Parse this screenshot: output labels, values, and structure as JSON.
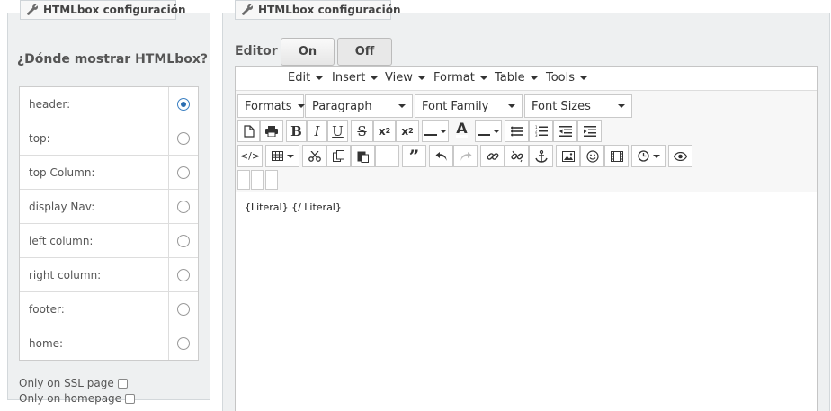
{
  "left_panel": {
    "legend": "HTMLbox configuración",
    "title": "¿Dónde mostrar HTMLbox?",
    "hooks": [
      {
        "label": "header:",
        "checked": true
      },
      {
        "label": "top:",
        "checked": false
      },
      {
        "label": "top Column:",
        "checked": false
      },
      {
        "label": "display Nav:",
        "checked": false
      },
      {
        "label": "left column:",
        "checked": false
      },
      {
        "label": "right column:",
        "checked": false
      },
      {
        "label": "footer:",
        "checked": false
      },
      {
        "label": "home:",
        "checked": false
      }
    ],
    "ssl_option": "Only on SSL page",
    "homepage_option": "Only on homepage"
  },
  "right_panel": {
    "legend": "HTMLbox configuración",
    "editor_label": "Editor",
    "on_label": "On",
    "off_label": "Off"
  },
  "menubar": [
    "Edit",
    "Insert",
    "View",
    "Format",
    "Table",
    "Tools"
  ],
  "dropdowns": {
    "formats": "Formats",
    "block": "Paragraph",
    "font_family": "Font Family",
    "font_sizes": "Font Sizes"
  },
  "editor_content": "{Literal} {/ Literal}",
  "icons": {
    "wrench": "wrench-icon",
    "toolbar": [
      "new-document-icon",
      "print-icon",
      "bold-icon",
      "italic-icon",
      "underline-icon",
      "strikethrough-icon",
      "superscript-icon",
      "subscript-icon",
      "text-color-icon",
      "background-color-icon",
      "bullet-list-icon",
      "numbered-list-icon",
      "outdent-icon",
      "indent-icon",
      "code-icon",
      "table-icon",
      "cut-icon",
      "copy-icon",
      "paste-icon",
      "blockquote-icon",
      "undo-icon",
      "redo-icon",
      "link-icon",
      "unlink-icon",
      "anchor-icon",
      "image-icon",
      "emoticon-icon",
      "media-icon",
      "insert-time-icon",
      "preview-icon"
    ]
  },
  "colors": {
    "panel_bg": "#eef0f1",
    "radio_checked": "#2a6db0"
  }
}
